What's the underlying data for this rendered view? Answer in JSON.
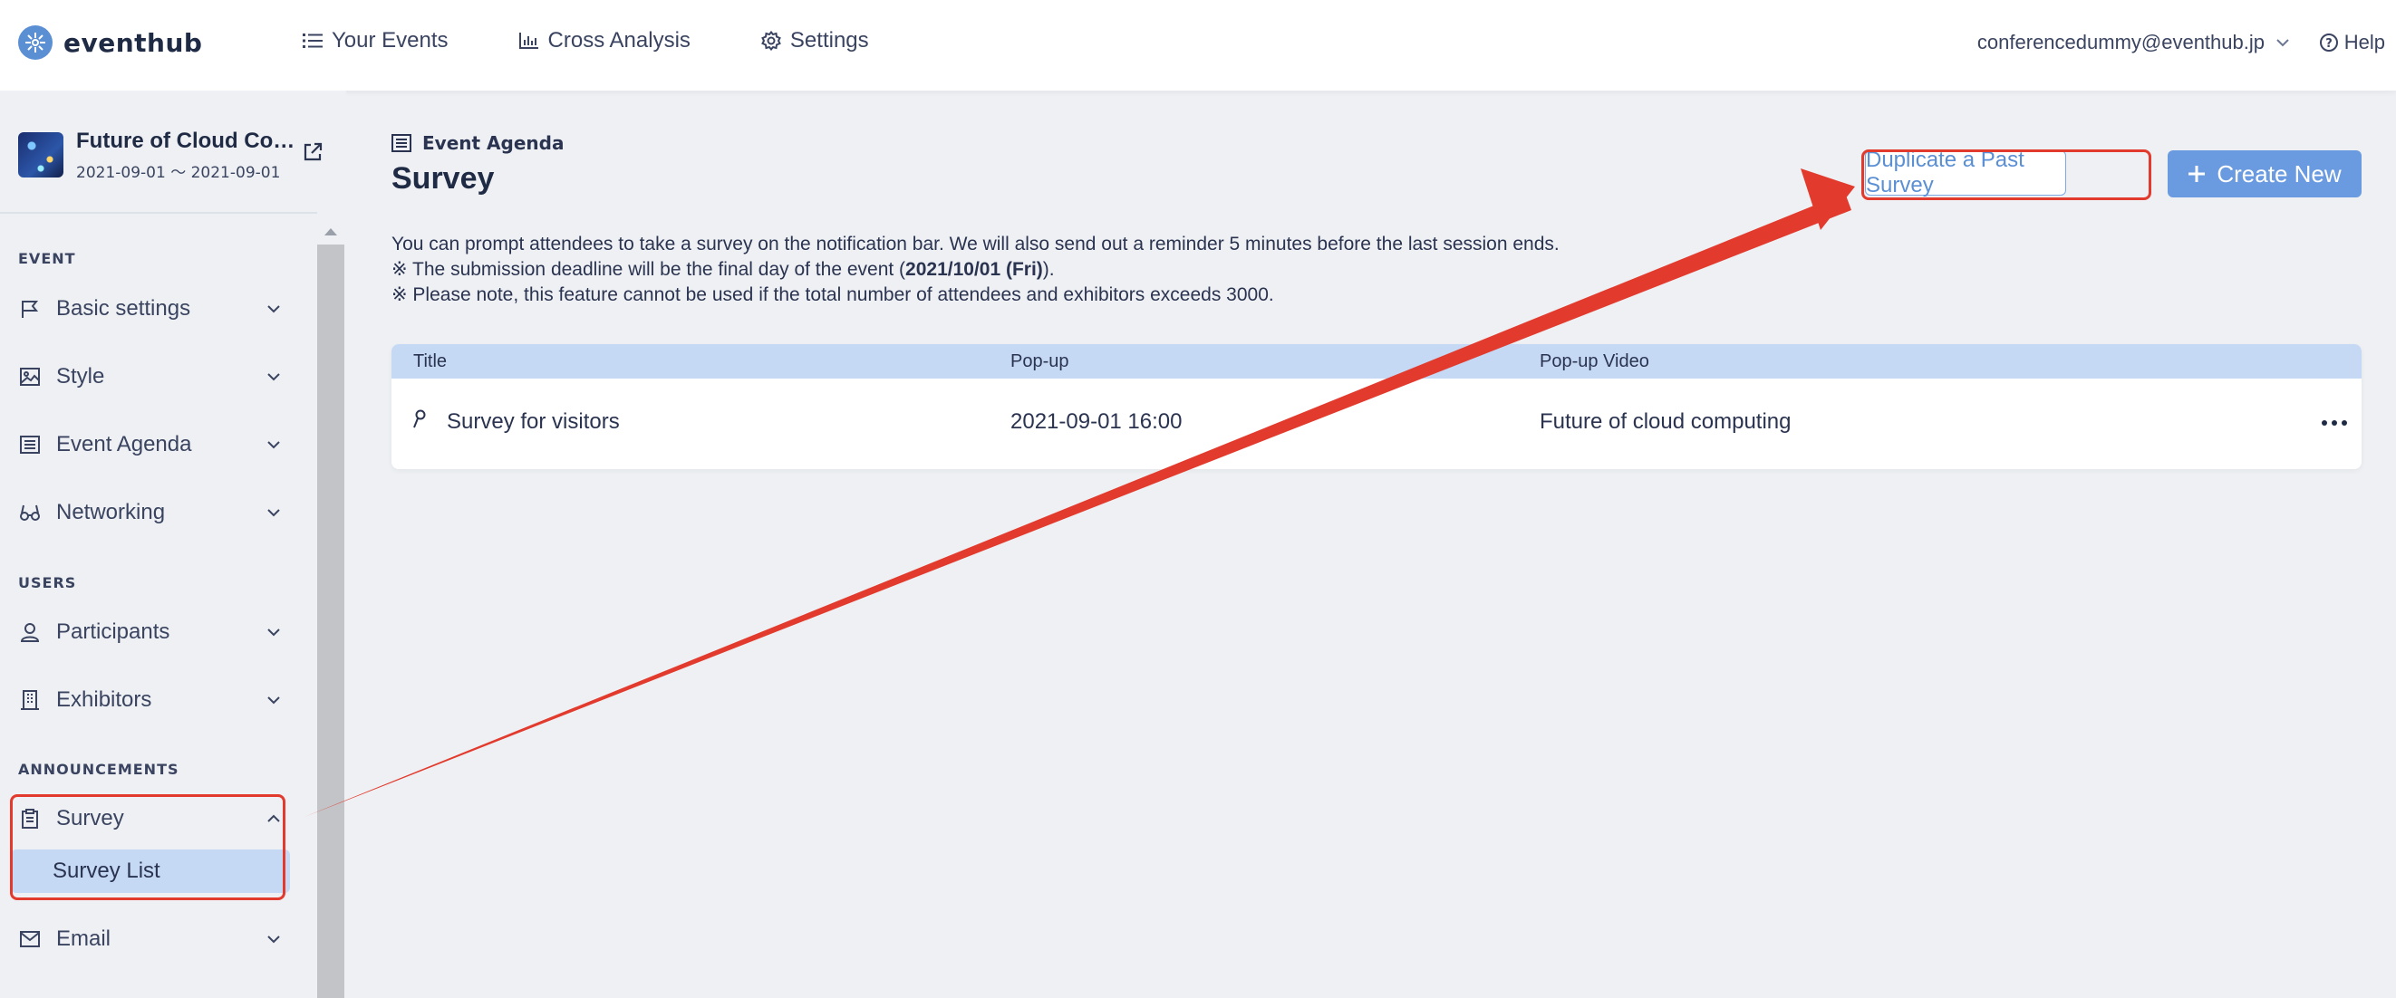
{
  "app": {
    "brand": "eventhub"
  },
  "nav": {
    "your_events": "Your Events",
    "cross_analysis": "Cross Analysis",
    "settings": "Settings"
  },
  "account": {
    "email": "conferencedummy@eventhub.jp",
    "help": "Help"
  },
  "event": {
    "title": "Future of Cloud Co…",
    "dates": "2021-09-01 ～ 2021-09-01"
  },
  "sidebar": {
    "sections": {
      "event": "EVENT",
      "users": "USERS",
      "announcements": "ANNOUNCEMENTS"
    },
    "items": {
      "basic_settings": "Basic settings",
      "style": "Style",
      "event_agenda": "Event Agenda",
      "networking": "Networking",
      "participants": "Participants",
      "exhibitors": "Exhibitors",
      "survey": "Survey",
      "survey_list": "Survey List",
      "email": "Email"
    }
  },
  "main": {
    "breadcrumb": "Event Agenda",
    "title": "Survey",
    "duplicate_button": "Duplicate a Past Survey",
    "create_button": "Create New",
    "desc_line1": "You can prompt attendees to take a survey on the notification bar. We will also send out a reminder 5 minutes before the last session ends.",
    "desc_line2_prefix": "※ The submission deadline will be the final day of the event (",
    "desc_line2_date": "2021/10/01 (Fri)",
    "desc_line2_suffix": ").",
    "desc_line3": "※ Please note, this feature cannot be used if the total number of attendees and exhibitors exceeds 3000.",
    "table": {
      "headers": {
        "title": "Title",
        "popup": "Pop-up",
        "popup_video": "Pop-up Video"
      },
      "rows": [
        {
          "title": "Survey for visitors",
          "popup": "2021-09-01 16:00",
          "popup_video": "Future of cloud computing"
        }
      ]
    }
  },
  "colors": {
    "accent": "#5b8fd4",
    "primary_button": "#6a9be0",
    "highlight": "#c5d9f4",
    "annotation_red": "#e23b2e"
  }
}
